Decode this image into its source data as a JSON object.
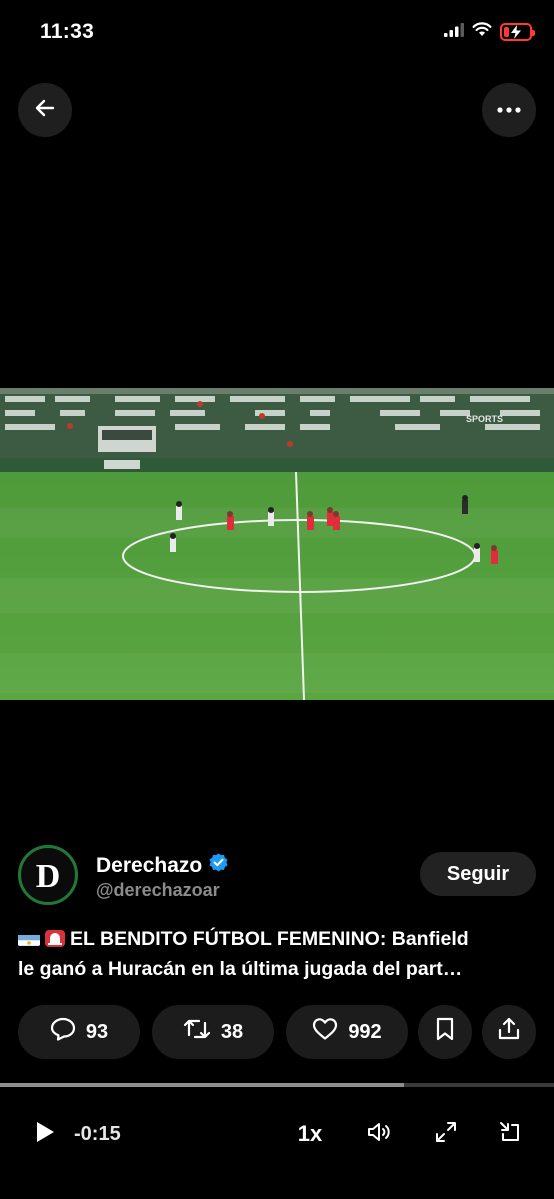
{
  "status_bar": {
    "time": "11:33",
    "battery_level": 0.2,
    "battery_color": "#ff3b30",
    "icons": [
      "cellular-signal-icon",
      "wifi-icon",
      "battery-charging-icon"
    ]
  },
  "header": {
    "back_icon": "arrow-left-icon",
    "more_icon": "more-horizontal-icon"
  },
  "video": {
    "broadcaster_watermark": "SPORTS"
  },
  "author": {
    "name": "Derechazo",
    "handle": "@derechazoar",
    "verified": true,
    "verified_color": "#1d9bf0",
    "avatar_letter": "D",
    "follow_label": "Seguir"
  },
  "tweet": {
    "line1": "EL BENDITO FÚTBOL FEMENINO: Banfield",
    "line2": "le ganó a Huracán en la última jugada del part…",
    "emoji": [
      "argentina-flag-icon",
      "siren-icon"
    ]
  },
  "actions": {
    "replies": "93",
    "reposts": "38",
    "likes": "992",
    "icons": [
      "reply-icon",
      "repost-icon",
      "heart-icon",
      "bookmark-icon",
      "share-icon"
    ]
  },
  "player": {
    "progress": 0.73,
    "time_remaining": "-0:15",
    "speed": "1x",
    "icons": [
      "play-icon",
      "volume-icon",
      "fullscreen-icon",
      "minimize-icon"
    ]
  }
}
